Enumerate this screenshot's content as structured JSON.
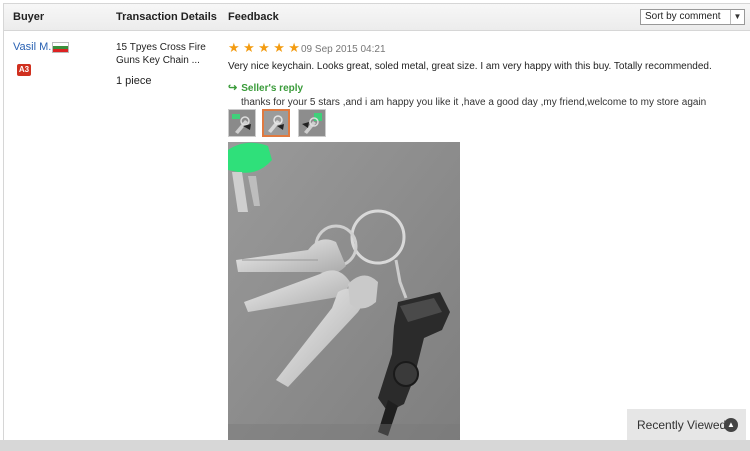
{
  "header": {
    "buyer": "Buyer",
    "transaction": "Transaction Details",
    "feedback": "Feedback",
    "sort_label": "Sort by comment",
    "sort_arrow": "▼"
  },
  "review": {
    "buyer_name": "Vasil M.",
    "buyer_level": "A3",
    "product": "15 Tpyes Cross Fire Guns Key Chain ...",
    "quantity": "1 piece",
    "rating": 5,
    "stars": [
      "★",
      "★",
      "★",
      "★",
      "★"
    ],
    "date": "09 Sep 2015 04:21",
    "comment": "Very nice keychain. Looks great, soled metal, great size. I am very happy with this buy. Totally recommended.",
    "reply_label": "Seller's reply",
    "reply_icon": "↪",
    "reply_text": "thanks for your 5 stars ,and i am happy you like it ,have a good day ,my friend,welcome to my store again"
  },
  "recently_viewed": {
    "label": "Recently Viewed",
    "icon": "▲"
  },
  "colors": {
    "link": "#2a62b3",
    "star": "#f39c12",
    "reply": "#3a9b3a",
    "badge": "#d0301f"
  }
}
